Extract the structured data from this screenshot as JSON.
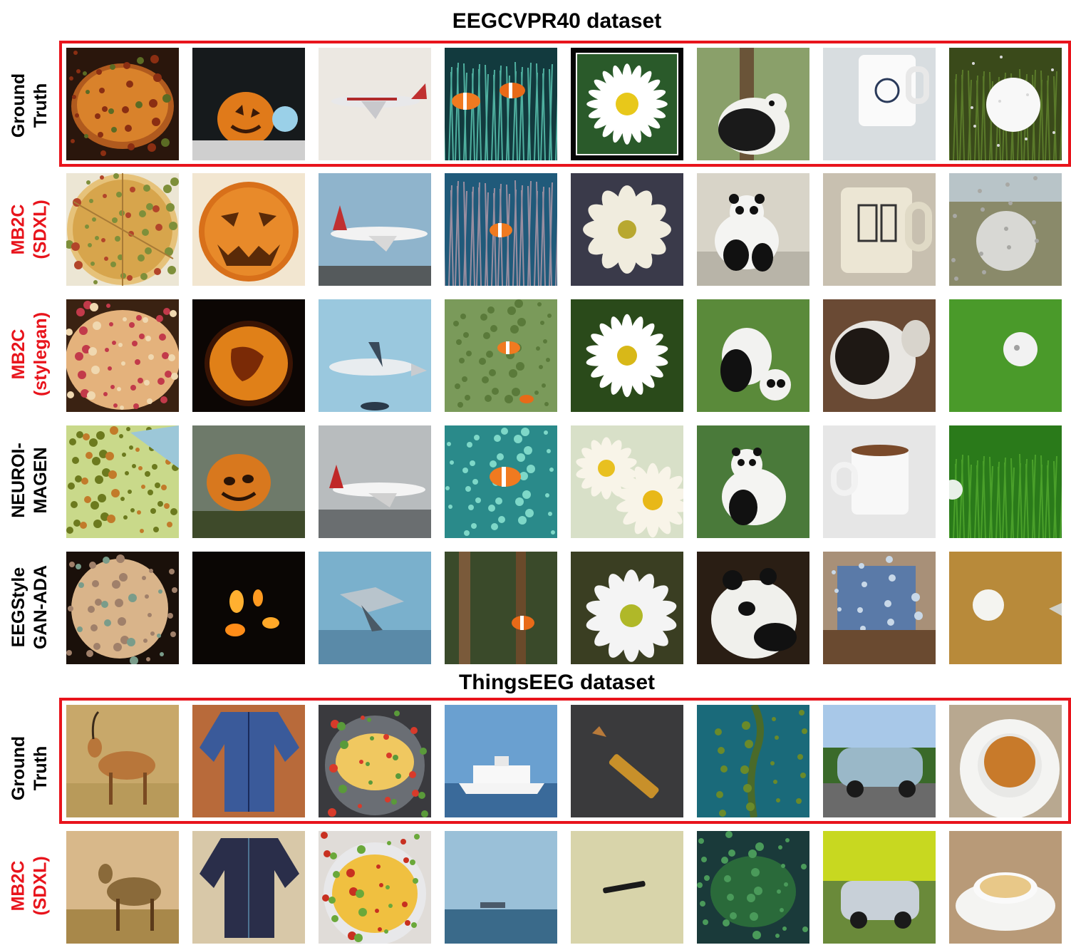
{
  "sections": [
    {
      "title": "EEGCVPR40 dataset",
      "highlight_color": "#e8141c",
      "columns": [
        "pizza",
        "jack-o-lantern",
        "airliner",
        "anemone-fish",
        "daisy",
        "giant-panda",
        "coffee-mug",
        "golf-ball"
      ],
      "rows": [
        {
          "label_lines": [
            "Ground",
            "Truth"
          ],
          "label_color": "#000000",
          "highlighted": true
        },
        {
          "label_lines": [
            "MB2C",
            "(SDXL)"
          ],
          "label_color": "#e8141c",
          "highlighted": false
        },
        {
          "label_lines": [
            "MB2C",
            "(stylegan)"
          ],
          "label_color": "#e8141c",
          "highlighted": false
        },
        {
          "label_lines": [
            "NEUROI-",
            "MAGEN"
          ],
          "label_color": "#000000",
          "highlighted": false
        },
        {
          "label_lines": [
            "EEGStyle",
            "GAN-ADA"
          ],
          "label_color": "#000000",
          "highlighted": false
        }
      ]
    },
    {
      "title": "ThingsEEG dataset",
      "highlight_color": "#e8141c",
      "columns": [
        "antelope",
        "pajamas",
        "omelet",
        "cruise-ship",
        "bullet",
        "kelp",
        "minivan",
        "creme-brulee"
      ],
      "rows": [
        {
          "label_lines": [
            "Ground",
            "Truth"
          ],
          "label_color": "#000000",
          "highlighted": true
        },
        {
          "label_lines": [
            "MB2C",
            "(SDXL)"
          ],
          "label_color": "#e8141c",
          "highlighted": false
        }
      ]
    }
  ]
}
